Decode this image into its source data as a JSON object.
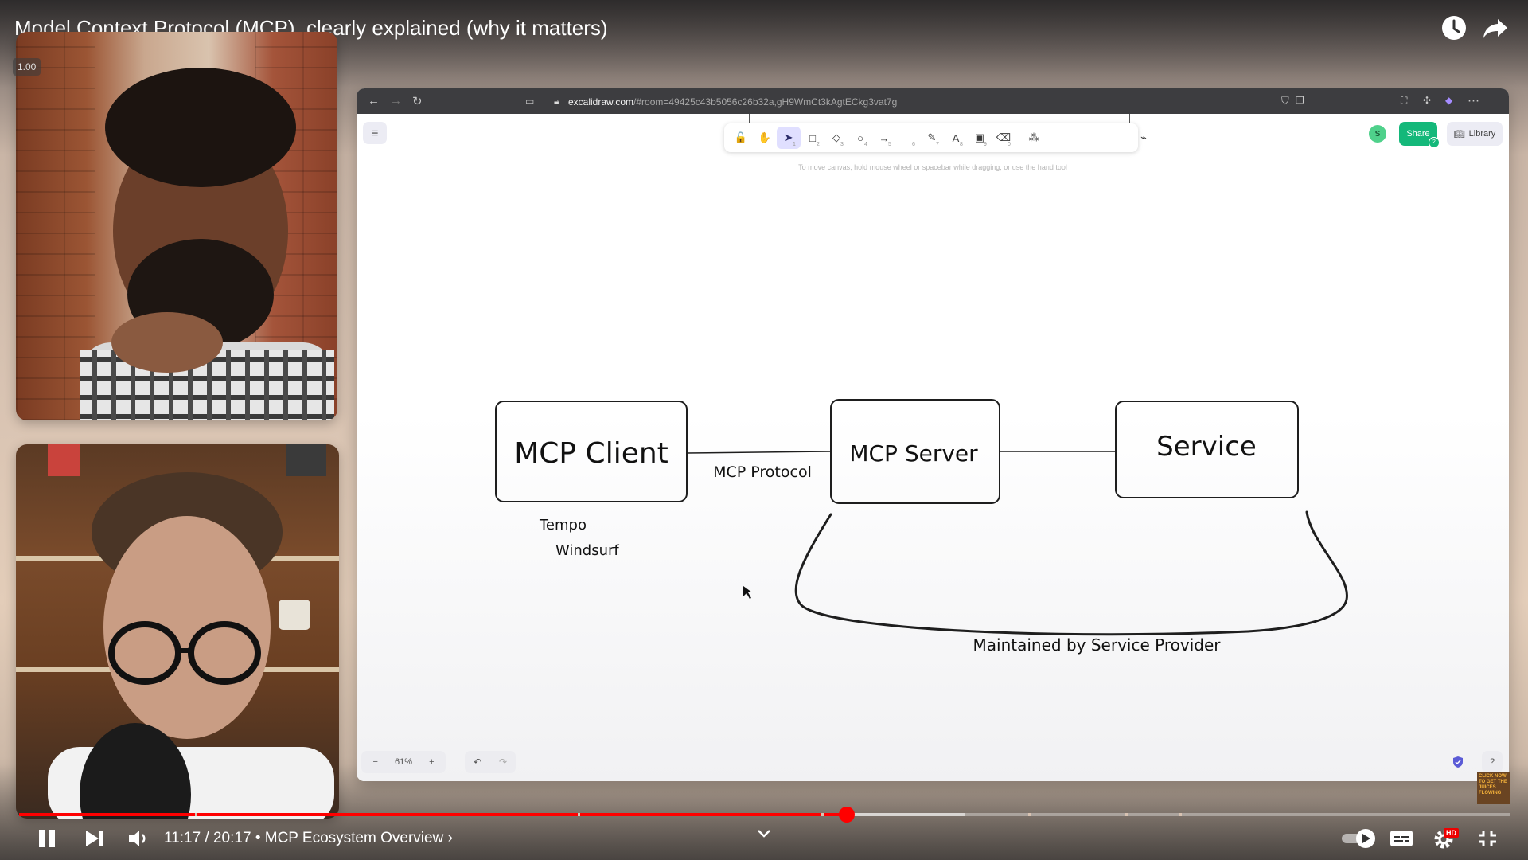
{
  "video": {
    "title": "Model Context Protocol (MCP), clearly explained (why it matters)",
    "speed_badge": "1.00",
    "current_time": "11:17",
    "duration": "20:17",
    "time_display": "11:17 / 20:17",
    "separator": "•",
    "chapter": "MCP Ecosystem Overview",
    "chapter_chevron": "›",
    "progress_fraction": 0.555,
    "buffered_fraction": 0.634,
    "accent_color": "#ff0000",
    "hd_badge": "HD",
    "corner_thumbnail_text": "CLICK NOW TO GET THE JUICES FLOWING"
  },
  "top_icons": [
    "watch-later-icon",
    "share-icon"
  ],
  "browser": {
    "url_host": "excalidraw.com",
    "url_rest": "/#room=49425c43b5056c26b32a,gH9WmCt3kAgtECkg3vat7g"
  },
  "excalidraw": {
    "hint": "To move canvas, hold mouse wheel or spacebar while dragging, or use the hand tool",
    "tools": [
      {
        "name": "lock-tool",
        "glyph": "🔓",
        "key": ""
      },
      {
        "name": "hand-tool",
        "glyph": "✋",
        "key": ""
      },
      {
        "name": "selection-tool",
        "glyph": "➤",
        "key": "1"
      },
      {
        "name": "rectangle-tool",
        "glyph": "□",
        "key": "2"
      },
      {
        "name": "diamond-tool",
        "glyph": "◇",
        "key": "3"
      },
      {
        "name": "ellipse-tool",
        "glyph": "○",
        "key": "4"
      },
      {
        "name": "arrow-tool",
        "glyph": "→",
        "key": "5"
      },
      {
        "name": "line-tool",
        "glyph": "—",
        "key": "6"
      },
      {
        "name": "draw-tool",
        "glyph": "✎",
        "key": "7"
      },
      {
        "name": "text-tool",
        "glyph": "A",
        "key": "8"
      },
      {
        "name": "image-tool",
        "glyph": "▣",
        "key": "9"
      },
      {
        "name": "eraser-tool",
        "glyph": "⌫",
        "key": "0"
      },
      {
        "name": "more-tools",
        "glyph": "⁂",
        "key": ""
      }
    ],
    "avatar_initial": "S",
    "share_label": "Share",
    "share_count": "2",
    "library_label": "Library",
    "zoom_level": "61%",
    "zoom_out": "−",
    "zoom_in": "+",
    "help": "?"
  },
  "diagram": {
    "client_label": "MCP Client",
    "server_label": "MCP Server",
    "service_label": "Service",
    "protocol_label": "MCP Protocol",
    "client_examples": [
      "Tempo",
      "Windsurf"
    ],
    "provider_label": "Maintained by Service Provider"
  }
}
